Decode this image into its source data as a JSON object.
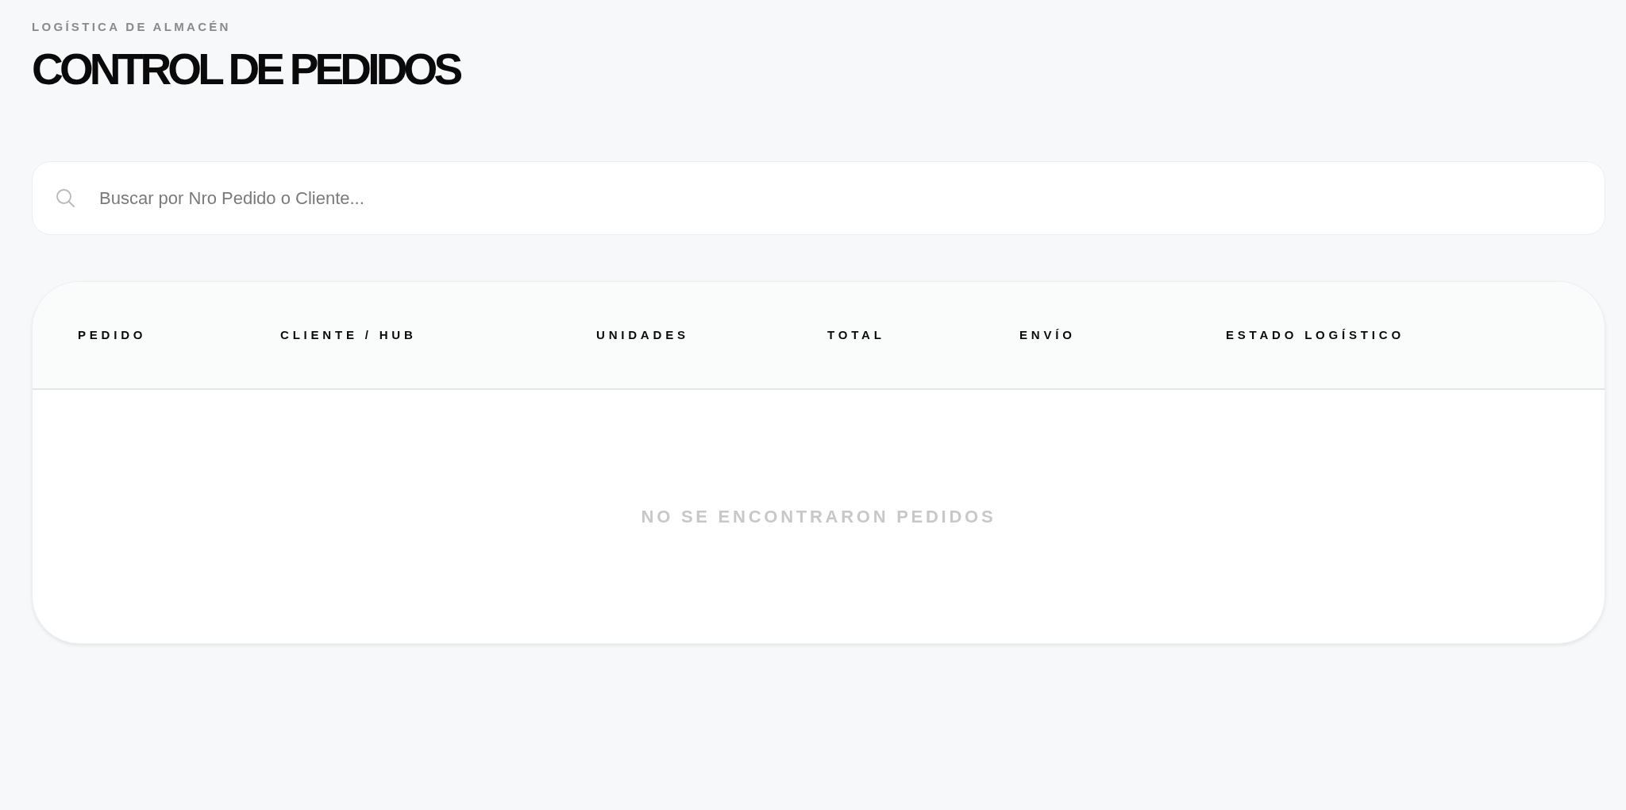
{
  "header": {
    "eyebrow": "LOGÍSTICA DE ALMACÉN",
    "title": "CONTROL DE PEDIDOS"
  },
  "search": {
    "placeholder": "Buscar por Nro Pedido o Cliente..."
  },
  "table": {
    "columns": [
      "PEDIDO",
      "CLIENTE / HUB",
      "UNIDADES",
      "TOTAL",
      "ENVÍO",
      "ESTADO LOGÍSTICO"
    ],
    "empty_message": "NO SE ENCONTRARON PEDIDOS"
  }
}
